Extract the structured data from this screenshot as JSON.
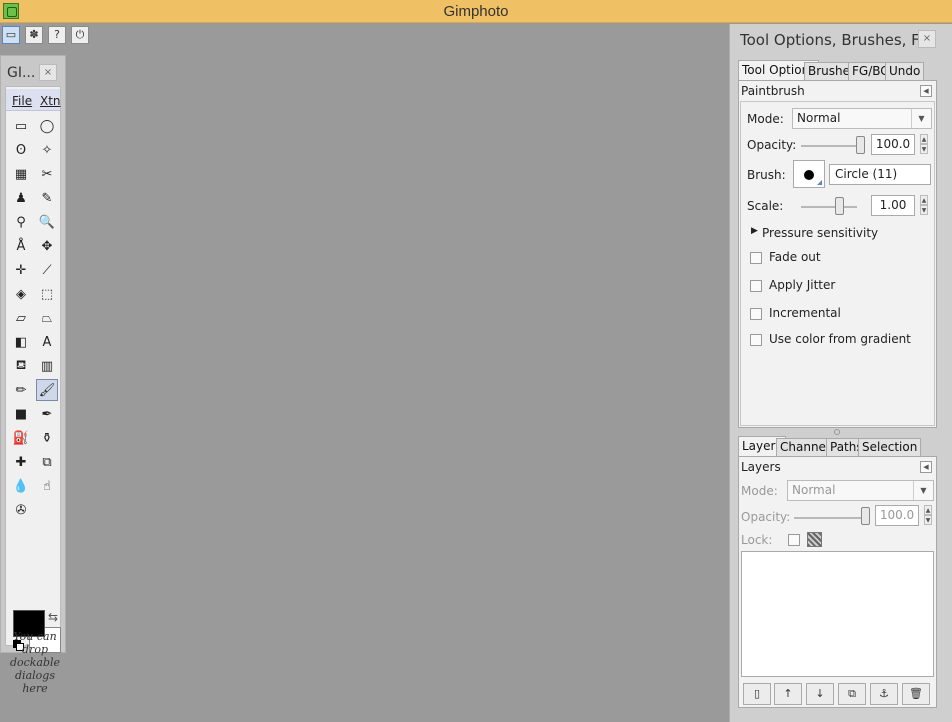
{
  "window": {
    "title": "Gimphoto"
  },
  "topbar": {
    "buttons": [
      {
        "icon": "window-icon",
        "glyph": "▭"
      },
      {
        "icon": "paw-icon",
        "glyph": "✽"
      },
      {
        "icon": "help-icon",
        "glyph": "?"
      },
      {
        "icon": "power-icon",
        "glyph": "⏻"
      }
    ]
  },
  "toolbox": {
    "title": "GI...",
    "close": "×",
    "menus": [
      "File",
      "Xtn"
    ],
    "tools": [
      {
        "icon": "rect-select-icon",
        "glyph": "▭"
      },
      {
        "icon": "ellipse-select-icon",
        "glyph": "◯"
      },
      {
        "icon": "lasso-icon",
        "glyph": "ʘ"
      },
      {
        "icon": "magic-wand-icon",
        "glyph": "✧"
      },
      {
        "icon": "select-by-color-icon",
        "glyph": "▦"
      },
      {
        "icon": "scissors-icon",
        "glyph": "✂"
      },
      {
        "icon": "foreground-select-icon",
        "glyph": "♟"
      },
      {
        "icon": "paths-icon",
        "glyph": "✎"
      },
      {
        "icon": "color-picker-icon",
        "glyph": "⚲"
      },
      {
        "icon": "zoom-icon",
        "glyph": "🔍"
      },
      {
        "icon": "measure-icon",
        "glyph": "Å"
      },
      {
        "icon": "move-icon",
        "glyph": "✥"
      },
      {
        "icon": "align-icon",
        "glyph": "✛"
      },
      {
        "icon": "crop-icon",
        "glyph": "⟋"
      },
      {
        "icon": "rotate-icon",
        "glyph": "◈"
      },
      {
        "icon": "scale-icon",
        "glyph": "⬚"
      },
      {
        "icon": "shear-icon",
        "glyph": "▱"
      },
      {
        "icon": "perspective-icon",
        "glyph": "⏢"
      },
      {
        "icon": "flip-icon",
        "glyph": "◧"
      },
      {
        "icon": "text-icon",
        "glyph": "A"
      },
      {
        "icon": "bucket-fill-icon",
        "glyph": "⛾"
      },
      {
        "icon": "blend-icon",
        "glyph": "▥"
      },
      {
        "icon": "pencil-icon",
        "glyph": "✏"
      },
      {
        "icon": "paintbrush-icon",
        "glyph": "🖌"
      },
      {
        "icon": "eraser-icon",
        "glyph": "■"
      },
      {
        "icon": "airbrush-icon",
        "glyph": "✒"
      },
      {
        "icon": "ink-icon",
        "glyph": "⛽"
      },
      {
        "icon": "clone-icon",
        "glyph": "⚱"
      },
      {
        "icon": "heal-icon",
        "glyph": "✚"
      },
      {
        "icon": "perspective-clone-icon",
        "glyph": "⧉"
      },
      {
        "icon": "blur-icon",
        "glyph": "💧"
      },
      {
        "icon": "smudge-icon",
        "glyph": "☝"
      },
      {
        "icon": "dodge-burn-icon",
        "glyph": "✇"
      }
    ],
    "fg_color": "#000000",
    "bg_color": "#ffffff",
    "drop_hint": [
      "You can",
      "drop",
      "dockable",
      "dialogs",
      "here"
    ]
  },
  "dock": {
    "title": "Tool Options, Brushes, FG...",
    "close": "×",
    "top_tabs": [
      "Tool Options",
      "Brushes",
      "FG/BG",
      "Undo"
    ],
    "tool_options": {
      "header": "Paintbrush",
      "mode_label": "Mode:",
      "mode_value": "Normal",
      "opacity_label": "Opacity:",
      "opacity_value": "100.0",
      "brush_label": "Brush:",
      "brush_value": "Circle (11)",
      "scale_label": "Scale:",
      "scale_value": "1.00",
      "pressure": "Pressure sensitivity",
      "checkboxes": [
        "Fade out",
        "Apply Jitter",
        "Incremental",
        "Use color from gradient"
      ]
    },
    "bottom_tabs": [
      "Layers",
      "Channels",
      "Paths",
      "Selection"
    ],
    "layers": {
      "header": "Layers",
      "mode_label": "Mode:",
      "mode_value": "Normal",
      "opacity_label": "Opacity:",
      "opacity_value": "100.0",
      "lock_label": "Lock:",
      "buttons": [
        {
          "icon": "new-layer-icon",
          "glyph": "▯"
        },
        {
          "icon": "raise-layer-icon",
          "glyph": "↑"
        },
        {
          "icon": "lower-layer-icon",
          "glyph": "↓"
        },
        {
          "icon": "duplicate-layer-icon",
          "glyph": "⧉"
        },
        {
          "icon": "anchor-layer-icon",
          "glyph": "⚓"
        },
        {
          "icon": "delete-layer-icon",
          "glyph": "🗑"
        }
      ]
    }
  }
}
